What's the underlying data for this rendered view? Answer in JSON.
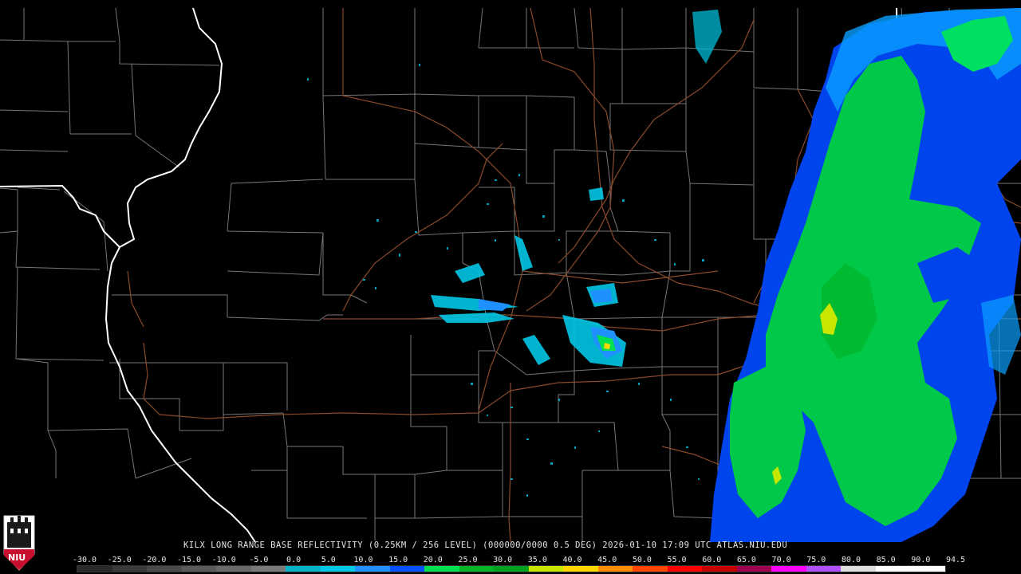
{
  "caption": "KILX LONG RANGE BASE REFLECTIVITY (0.25KM / 256 LEVEL) (000000/0000 0.5 DEG) 2026-01-10 17:09 UTC  ATLAS.NIU.EDU",
  "logo_text": "NIU",
  "colors": {
    "background": "#000000",
    "county_line": "#8c8c8c",
    "road": "#8a4a2a",
    "state_line": "#ffffff"
  },
  "scale": {
    "labels": [
      "-30.0",
      "-25.0",
      "-20.0",
      "-15.0",
      "-10.0",
      "-5.0",
      "0.0",
      "5.0",
      "10.0",
      "15.0",
      "20.0",
      "25.0",
      "30.0",
      "35.0",
      "40.0",
      "45.0",
      "50.0",
      "55.0",
      "60.0",
      "65.0",
      "70.0",
      "75.0",
      "80.0",
      "85.0",
      "90.0",
      "94.5"
    ],
    "colors": [
      "#2a2a2a",
      "#3a3a3a",
      "#4a4a4a",
      "#5a5a5a",
      "#6a6a6a",
      "#7a7a7a",
      "#00b4c8",
      "#00c8e6",
      "#1e90ff",
      "#0050ff",
      "#00e050",
      "#00b428",
      "#00a020",
      "#c8e600",
      "#ffd700",
      "#ff8c00",
      "#ff4500",
      "#ff0000",
      "#c80000",
      "#a00050",
      "#ff00ff",
      "#b050ff",
      "#e0e0e0",
      "#ffffff",
      "#ffffff"
    ]
  }
}
